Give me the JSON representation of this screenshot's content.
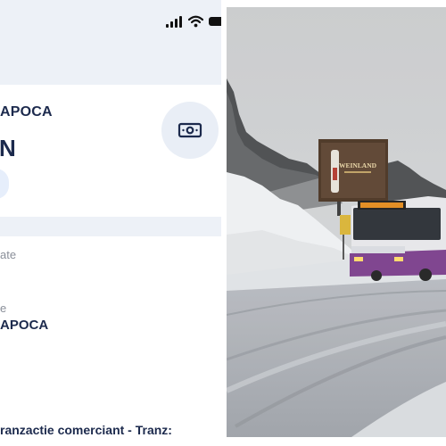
{
  "phone": {
    "transaction": {
      "merchant": "APOCA",
      "amount_fragment": "N"
    },
    "details": {
      "label_1": "ate",
      "label_2": "e",
      "value": "APOCA",
      "description": "ranzactie comerciant - Tranz:"
    }
  },
  "billboard": {
    "brand": "WEINLAND"
  },
  "icons": [
    "signal-icon",
    "wifi-icon",
    "battery-icon",
    "cash-icon"
  ]
}
